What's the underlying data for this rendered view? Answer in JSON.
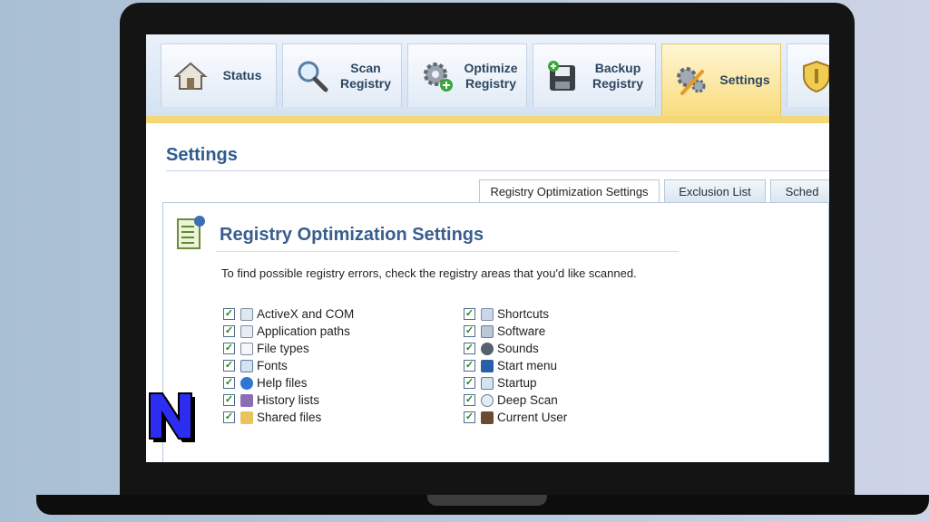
{
  "toolbar": {
    "tabs": [
      {
        "label": "Status",
        "icon": "house-icon"
      },
      {
        "label": "Scan\nRegistry",
        "icon": "magnifier-icon"
      },
      {
        "label": "Optimize\nRegistry",
        "icon": "gear-plus-icon"
      },
      {
        "label": "Backup\nRegistry",
        "icon": "floppy-disk-icon"
      },
      {
        "label": "Settings",
        "icon": "gears-wrench-icon"
      }
    ],
    "active_tab": "Settings"
  },
  "page": {
    "title": "Settings"
  },
  "subtabs": [
    {
      "label": "Registry Optimization Settings"
    },
    {
      "label": "Exclusion List"
    },
    {
      "label": "Sched"
    }
  ],
  "section": {
    "title": "Registry Optimization Settings",
    "instructions": "To find possible registry errors, check the registry areas that you'd like scanned."
  },
  "options_left": [
    {
      "label": "ActiveX and COM",
      "checked": true
    },
    {
      "label": "Application paths",
      "checked": true
    },
    {
      "label": "File types",
      "checked": true
    },
    {
      "label": "Fonts",
      "checked": true
    },
    {
      "label": "Help files",
      "checked": true
    },
    {
      "label": "History lists",
      "checked": true
    },
    {
      "label": "Shared files",
      "checked": true
    }
  ],
  "options_right": [
    {
      "label": "Shortcuts",
      "checked": true
    },
    {
      "label": "Software",
      "checked": true
    },
    {
      "label": "Sounds",
      "checked": true
    },
    {
      "label": "Start menu",
      "checked": true
    },
    {
      "label": "Startup",
      "checked": true
    },
    {
      "label": "Deep Scan",
      "checked": true
    },
    {
      "label": "Current User",
      "checked": true
    }
  ],
  "colors": {
    "accent": "#2f5b8f",
    "active_tab": "#f8dc7e",
    "check": "#1e8a1e"
  }
}
